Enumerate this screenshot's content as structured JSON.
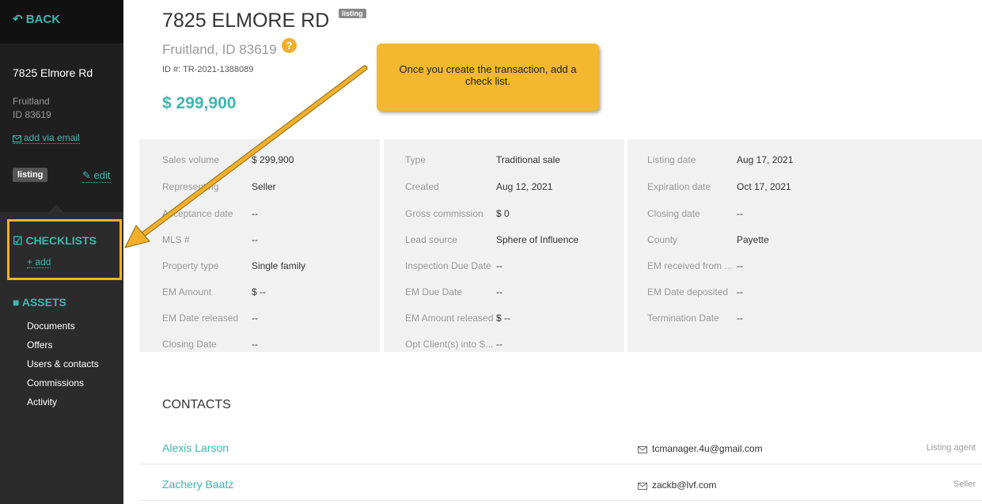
{
  "sidebar": {
    "back_label": "BACK",
    "address_title": "7825 Elmore Rd",
    "city": "Fruitland",
    "state_zip": "ID 83619",
    "add_via_email": "add via email",
    "status_badge": "listing",
    "edit_label": "edit",
    "checklists_label": "CHECKLISTS",
    "checklists_add": "+ add",
    "assets_label": "ASSETS",
    "asset_links": [
      "Documents",
      "Offers",
      "Users & contacts",
      "Commissions",
      "Activity"
    ]
  },
  "header": {
    "title": "7825 ELMORE RD",
    "badge": "listing",
    "subtitle": "Fruitland, ID 83619",
    "help_glyph": "?",
    "id_line": "ID #: TR-2021-1388089",
    "price": "$ 299,900"
  },
  "callout": {
    "line1": "Once you create the transaction, add a",
    "line2": "check list.",
    "color": "#f3b730"
  },
  "details": {
    "col1": [
      {
        "label": "Sales volume",
        "value": "$ 299,900"
      },
      {
        "label": "Representing",
        "value": "Seller"
      },
      {
        "label": "Acceptance date",
        "value": "--"
      },
      {
        "label": "MLS #",
        "value": "--"
      },
      {
        "label": "Property type",
        "value": "Single family"
      },
      {
        "label": "EM Amount",
        "value": "$ --"
      },
      {
        "label": "EM Date released",
        "value": "--"
      },
      {
        "label": "Closing Date",
        "value": "--"
      }
    ],
    "col2": [
      {
        "label": "Type",
        "value": "Traditional sale"
      },
      {
        "label": "Created",
        "value": "Aug 12, 2021"
      },
      {
        "label": "Gross commission",
        "value": "$ 0"
      },
      {
        "label": "Lead source",
        "value": "Sphere of Influence"
      },
      {
        "label": "Inspection Due Date",
        "value": "--"
      },
      {
        "label": "EM Due Date",
        "value": "--"
      },
      {
        "label": "EM Amount released",
        "value": "$ --"
      },
      {
        "label": "Opt Client(s) into S...",
        "value": "--"
      }
    ],
    "col3": [
      {
        "label": "Listing date",
        "value": "Aug 17, 2021"
      },
      {
        "label": "Expiration date",
        "value": "Oct 17, 2021"
      },
      {
        "label": "Closing date",
        "value": "--"
      },
      {
        "label": "County",
        "value": "Payette"
      },
      {
        "label": "EM received from ...",
        "value": "--"
      },
      {
        "label": "EM Date deposited",
        "value": "--"
      },
      {
        "label": "Termination Date",
        "value": "--"
      }
    ]
  },
  "contacts": {
    "title": "CONTACTS",
    "rows": [
      {
        "name": "Alexis Larson",
        "email": "tcmanager.4u@gmail.com",
        "role": "Listing agent"
      },
      {
        "name": "Zachery Baatz",
        "email": "zackb@lvf.com",
        "role": "Seller"
      }
    ]
  },
  "colors": {
    "accent": "#42b5ad",
    "highlight": "#f2b02a",
    "sidebar": "#1f1f1f"
  }
}
